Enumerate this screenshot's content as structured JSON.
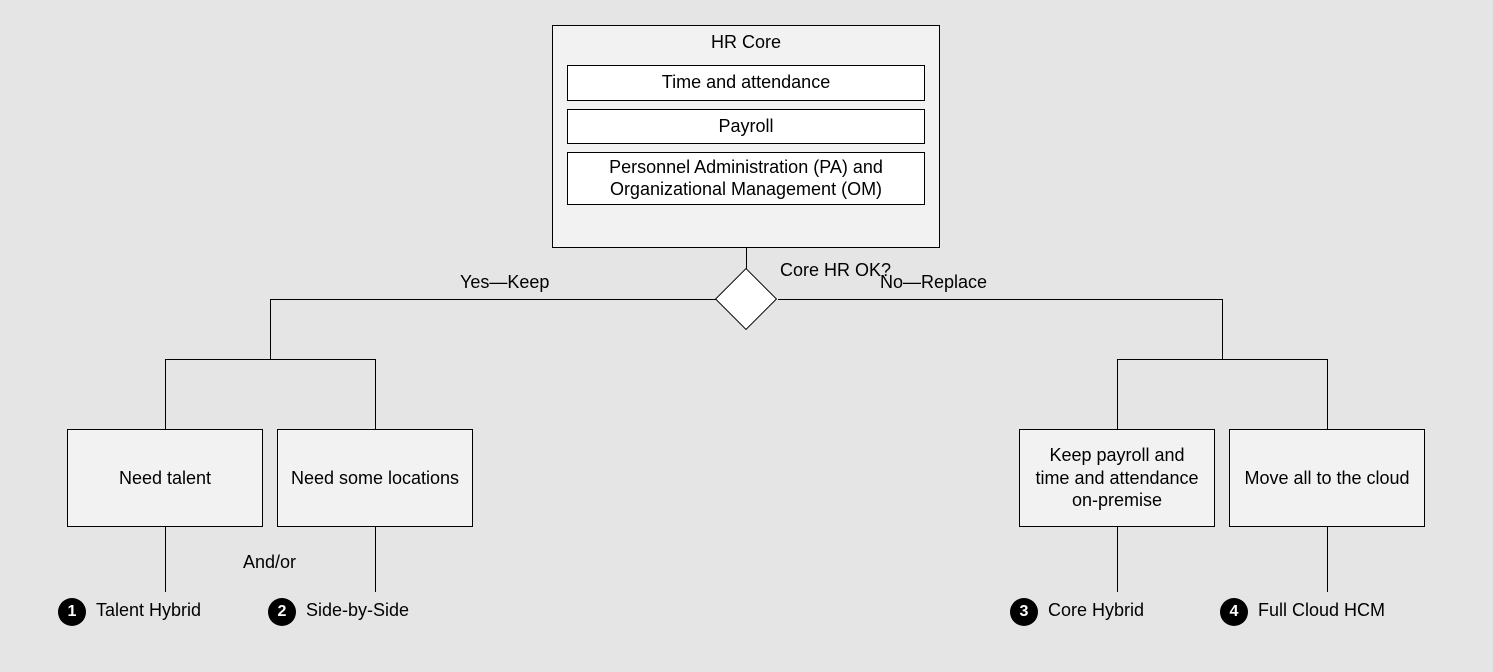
{
  "core": {
    "title": "HR Core",
    "items": [
      "Time and attendance",
      "Payroll",
      "Personnel Administration (PA) and Organizational Management (OM)"
    ]
  },
  "decision": {
    "question": "Core HR OK?",
    "yes_label": "Yes—Keep",
    "no_label": "No—Replace",
    "andor": "And/or"
  },
  "options": [
    {
      "text": "Need talent",
      "result": "Talent Hybrid"
    },
    {
      "text": "Need some locations",
      "result": "Side-by-Side"
    },
    {
      "text": "Keep payroll and time and attendance on-premise",
      "result": "Core Hybrid"
    },
    {
      "text": "Move all to the cloud",
      "result": "Full Cloud HCM"
    }
  ]
}
